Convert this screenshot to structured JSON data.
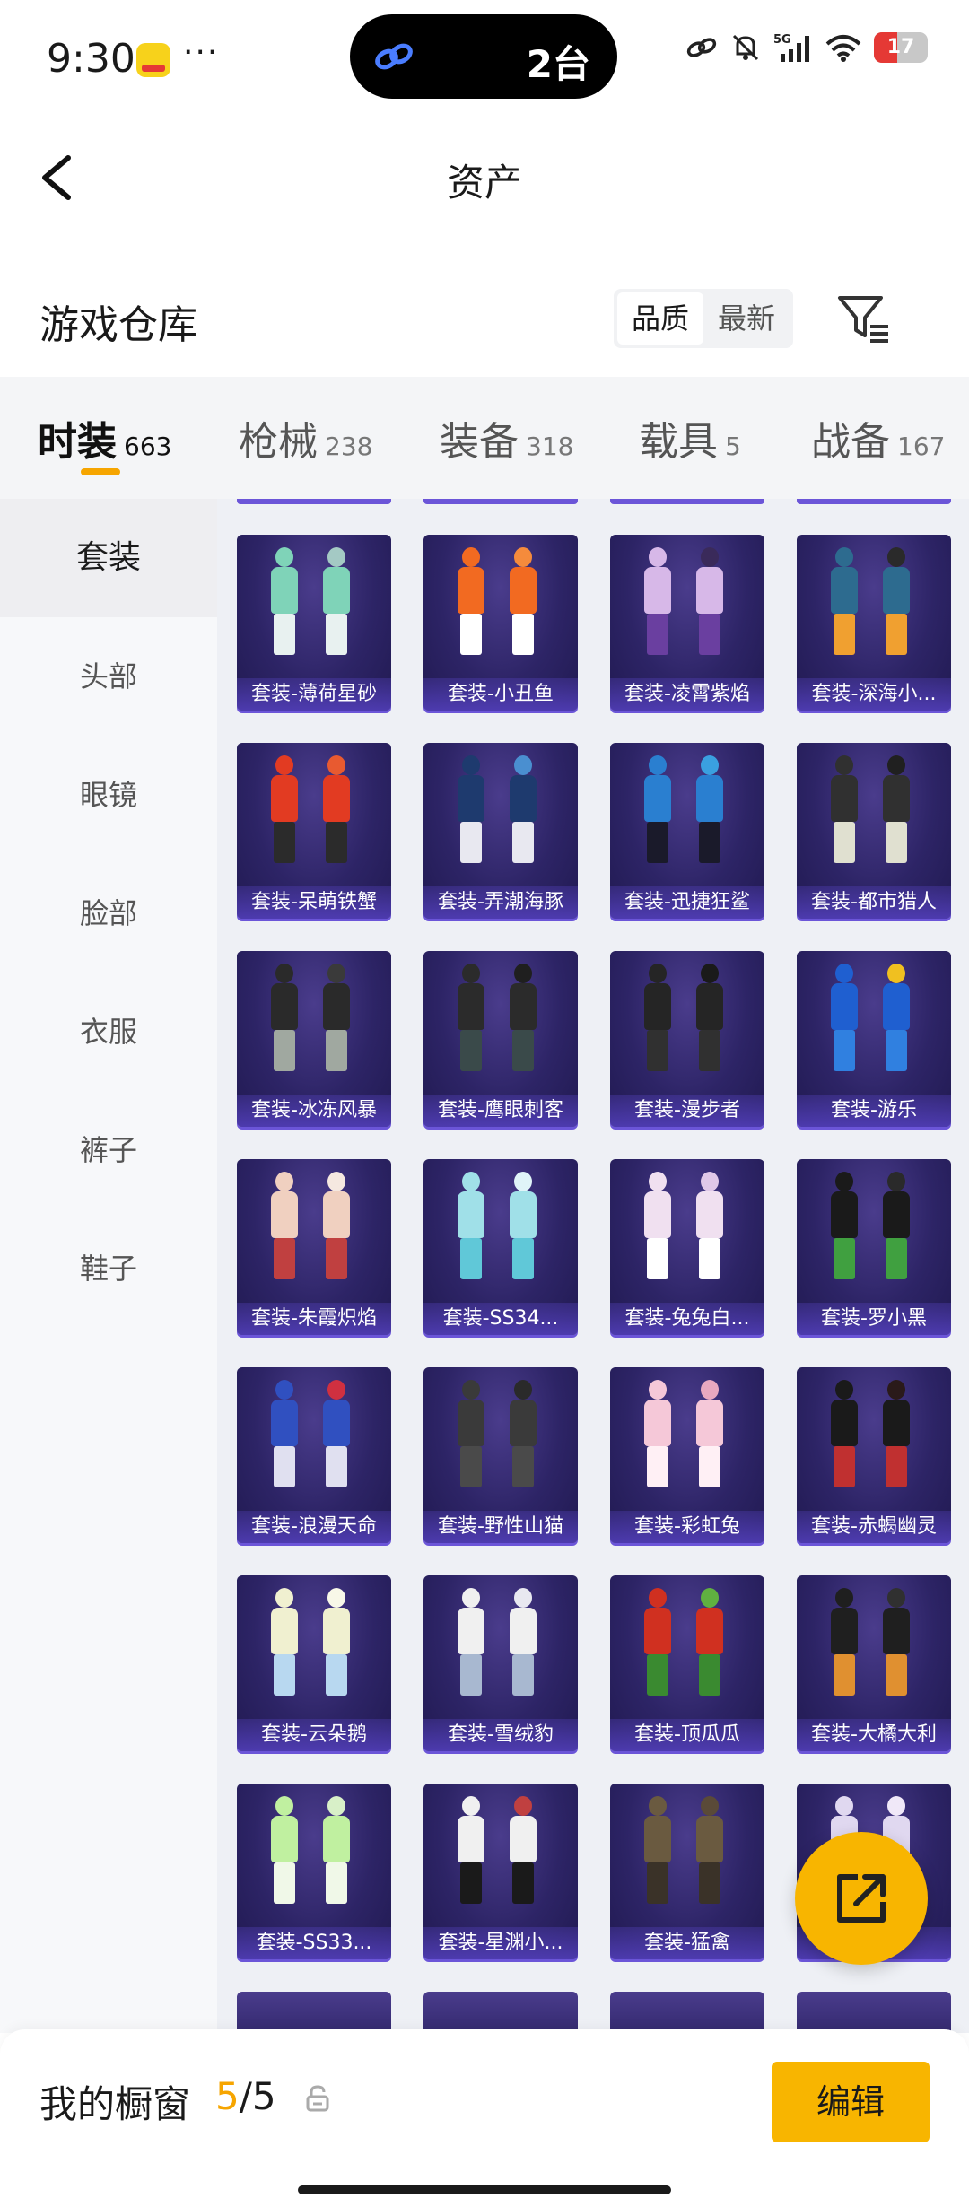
{
  "status_bar": {
    "time": "9:30",
    "dots": "···",
    "island_text": "2台",
    "battery": "17",
    "network": "5G"
  },
  "nav": {
    "title": "资产",
    "back_icon": "chevron-left-icon"
  },
  "warehouse": {
    "title": "游戏仓库",
    "sort_options": [
      "品质",
      "最新"
    ],
    "active_sort": "品质",
    "filter_icon": "filter-icon"
  },
  "category_tabs": [
    {
      "label": "时装",
      "count": "663",
      "active": true
    },
    {
      "label": "枪械",
      "count": "238",
      "active": false
    },
    {
      "label": "装备",
      "count": "318",
      "active": false
    },
    {
      "label": "载具",
      "count": "5",
      "active": false
    },
    {
      "label": "战备",
      "count": "167",
      "active": false
    }
  ],
  "sidebar": {
    "items": [
      {
        "label": "套装",
        "active": true
      },
      {
        "label": "头部",
        "active": false
      },
      {
        "label": "眼镜",
        "active": false
      },
      {
        "label": "脸部",
        "active": false
      },
      {
        "label": "衣服",
        "active": false
      },
      {
        "label": "裤子",
        "active": false
      },
      {
        "label": "鞋子",
        "active": false
      }
    ]
  },
  "items": [
    {
      "label": "套装-薄荷星砂",
      "colors": [
        "#7fd3b8",
        "#e8f1f0",
        "#a4c9c4"
      ]
    },
    {
      "label": "套装-小丑鱼",
      "colors": [
        "#f26a21",
        "#ffffff",
        "#f58b3c"
      ]
    },
    {
      "label": "套装-凌霄紫焰",
      "colors": [
        "#d7b8e8",
        "#6a3fa0",
        "#3a2a5a"
      ]
    },
    {
      "label": "套装-深海小...",
      "colors": [
        "#2d6b8f",
        "#f0a030",
        "#2a2a2a"
      ]
    },
    {
      "label": "套装-呆萌铁蟹",
      "colors": [
        "#e23b22",
        "#2b2b2b",
        "#e85a30"
      ]
    },
    {
      "label": "套装-弄潮海豚",
      "colors": [
        "#1e3a6e",
        "#e8e8f0",
        "#4a8fd0"
      ]
    },
    {
      "label": "套装-迅捷狂鲨",
      "colors": [
        "#2a7fd0",
        "#1a1a2a",
        "#3aa0e0"
      ]
    },
    {
      "label": "套装-都市猎人",
      "colors": [
        "#303030",
        "#e0e0d0",
        "#202020"
      ]
    },
    {
      "label": "套装-冰冻风暴",
      "colors": [
        "#2a2a2a",
        "#a0a8a0",
        "#3a3a3a"
      ]
    },
    {
      "label": "套装-鹰眼刺客",
      "colors": [
        "#2b2b2b",
        "#3a4a4a",
        "#1f1f1f"
      ]
    },
    {
      "label": "套装-漫步者",
      "colors": [
        "#252525",
        "#303030",
        "#1a1a1a"
      ]
    },
    {
      "label": "套装-游乐",
      "colors": [
        "#1f5fd0",
        "#3080e0",
        "#f0c020"
      ]
    },
    {
      "label": "套装-朱霞炽焰",
      "colors": [
        "#f0d0c0",
        "#c04040",
        "#f5e8e0"
      ]
    },
    {
      "label": "套装-SS34...",
      "colors": [
        "#a0e0e8",
        "#60c8d8",
        "#e0f4f8"
      ]
    },
    {
      "label": "套装-兔兔白...",
      "colors": [
        "#f0e0f0",
        "#ffffff",
        "#e0c8e8"
      ]
    },
    {
      "label": "套装-罗小黑",
      "colors": [
        "#1a1a1a",
        "#40a040",
        "#2a2a2a"
      ]
    },
    {
      "label": "套装-浪漫天命",
      "colors": [
        "#3050c0",
        "#e0e0f0",
        "#d03040"
      ]
    },
    {
      "label": "套装-野性山猫",
      "colors": [
        "#3a3a3a",
        "#4a4a4a",
        "#2a2a2a"
      ]
    },
    {
      "label": "套装-彩虹兔",
      "colors": [
        "#f5c8d8",
        "#fff0f5",
        "#e8a8c0"
      ]
    },
    {
      "label": "套装-赤蝎幽灵",
      "colors": [
        "#1a1a1a",
        "#c03030",
        "#2a1a1a"
      ]
    },
    {
      "label": "套装-云朵鹅",
      "colors": [
        "#f0f0d0",
        "#b8d8f0",
        "#f8f8e8"
      ]
    },
    {
      "label": "套装-雪绒豹",
      "colors": [
        "#f0f0f0",
        "#a8b8d0",
        "#e8e8f0"
      ]
    },
    {
      "label": "套装-顶瓜瓜",
      "colors": [
        "#d03020",
        "#3a8a30",
        "#60b040"
      ]
    },
    {
      "label": "套装-大橘大利",
      "colors": [
        "#1f1f1f",
        "#e09030",
        "#303030"
      ]
    },
    {
      "label": "套装-SS33...",
      "colors": [
        "#c0f0a0",
        "#f0f8e8",
        "#d8f0c8"
      ]
    },
    {
      "label": "套装-星渊小...",
      "colors": [
        "#f0f0f0",
        "#1a1a1a",
        "#c04040"
      ]
    },
    {
      "label": "套装-猛禽",
      "colors": [
        "#6a5a40",
        "#3a3228",
        "#5a4a38"
      ]
    },
    {
      "label": "",
      "colors": [
        "#e0d8f0",
        "#c0b8e0",
        "#f0e8f8"
      ]
    }
  ],
  "fab": {
    "icon": "share-icon"
  },
  "bottom_bar": {
    "label": "我的橱窗",
    "count_current": "5",
    "count_sep": "/",
    "count_total": "5",
    "lock_icon": "lock-icon",
    "edit_label": "编辑"
  },
  "colors": {
    "accent": "#f8b500",
    "card_bg": "#2d2466",
    "card_label": "#5440be"
  }
}
